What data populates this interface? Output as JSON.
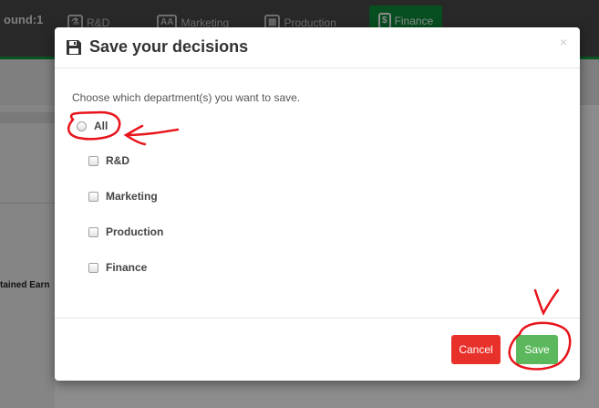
{
  "background": {
    "round_label": "ound:1",
    "tabs": [
      {
        "icon": "rd-icon",
        "label": "R&D"
      },
      {
        "icon": "marketing-icon",
        "label": "Marketing"
      },
      {
        "icon": "production-icon",
        "label": "Production"
      },
      {
        "icon": "finance-icon",
        "label": "Finance"
      }
    ],
    "retained_label": "tained Earn"
  },
  "modal": {
    "title": "Save your decisions",
    "close": "×",
    "prompt": "Choose which department(s) you want to save.",
    "options": {
      "all": "All",
      "rd": "R&D",
      "marketing": "Marketing",
      "production": "Production",
      "finance": "Finance"
    },
    "cancel_label": "Cancel",
    "save_label": "Save"
  },
  "colors": {
    "header_bg": "#4a4a4a",
    "active_tab": "#0d8f3c",
    "cancel": "#e9312b",
    "save": "#5cb85c",
    "annotation": "#e8141b"
  }
}
